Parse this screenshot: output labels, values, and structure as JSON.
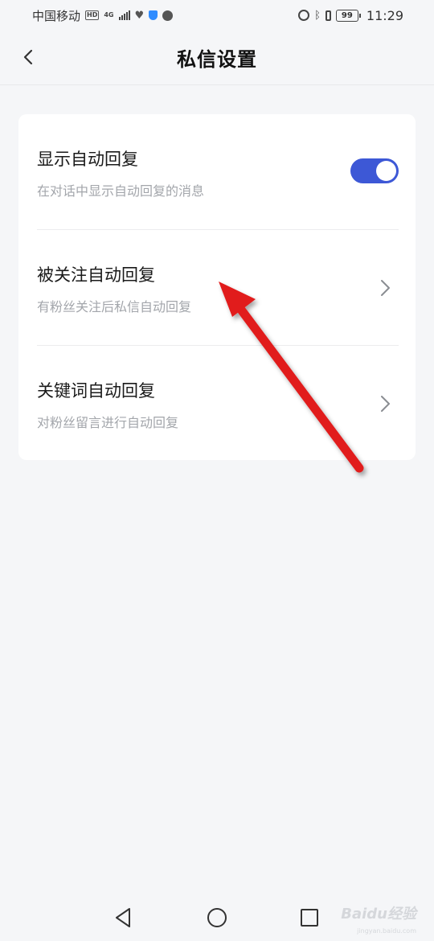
{
  "status_bar": {
    "carrier": "中国移动",
    "hd_badge": "HD",
    "network": "4G",
    "battery": "99",
    "time": "11:29"
  },
  "header": {
    "title": "私信设置",
    "back_icon": "chevron-left-icon"
  },
  "settings": [
    {
      "title": "显示自动回复",
      "subtitle": "在对话中显示自动回复的消息",
      "control": "toggle",
      "enabled": true
    },
    {
      "title": "被关注自动回复",
      "subtitle": "有粉丝关注后私信自动回复",
      "control": "chevron-right-icon"
    },
    {
      "title": "关键词自动回复",
      "subtitle": "对粉丝留言进行自动回复",
      "control": "chevron-right-icon"
    }
  ],
  "annotation": {
    "arrow_color": "#e11a1a"
  },
  "nav_bar": {
    "back": "triangle-back-icon",
    "home": "circle-home-icon",
    "recents": "square-recents-icon"
  },
  "watermark": {
    "text": "Baidu经验",
    "sub": "jingyan.baidu.com"
  },
  "colors": {
    "accent": "#3d58d6",
    "background": "#f5f6f8"
  }
}
